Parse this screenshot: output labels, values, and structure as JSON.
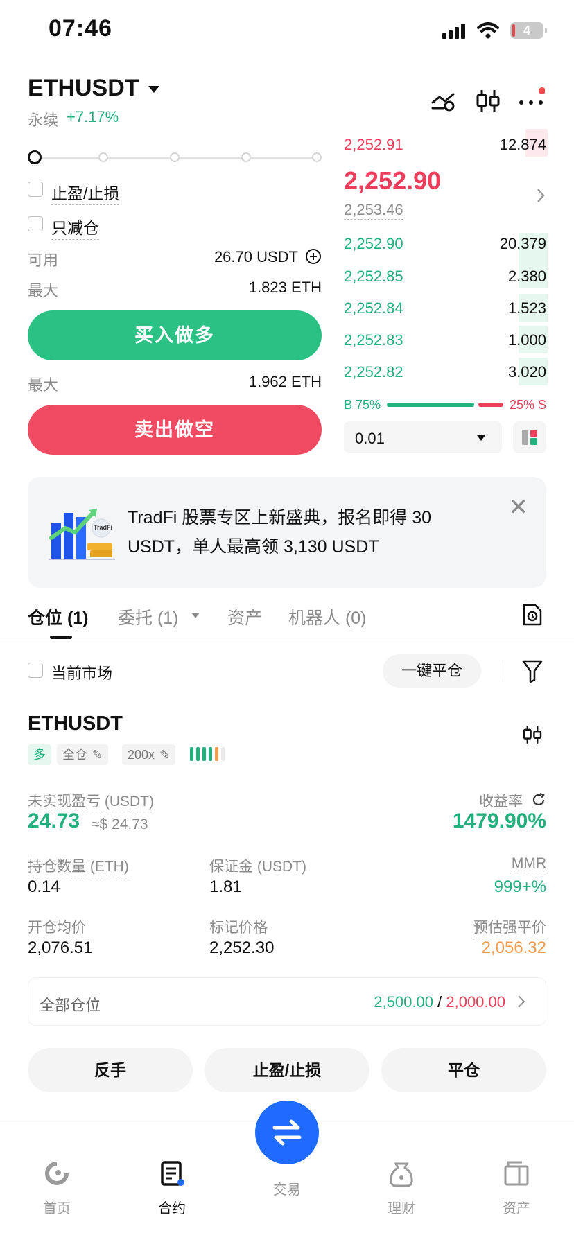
{
  "status_bar": {
    "time": "07:46",
    "battery": "4"
  },
  "header": {
    "pair": "ETHUSDT",
    "contract_type": "永续",
    "change_pct": "+7.17%"
  },
  "order_form": {
    "tp_sl_label": "止盈/止损",
    "reduce_only_label": "只减仓",
    "available_label": "可用",
    "available_value": "26.70 USDT",
    "max_label": "最大",
    "max_buy_value": "1.823 ETH",
    "buy_button": "买入做多",
    "max_sell_value": "1.962 ETH",
    "sell_button": "卖出做空"
  },
  "order_book": {
    "ask": {
      "price": "2,252.91",
      "qty": "12.874"
    },
    "last_price": "2,252.90",
    "mark_price": "2,253.46",
    "bids": [
      {
        "price": "2,252.90",
        "qty": "20.379"
      },
      {
        "price": "2,252.85",
        "qty": "2.380"
      },
      {
        "price": "2,252.84",
        "qty": "1.523"
      },
      {
        "price": "2,252.83",
        "qty": "1.000"
      },
      {
        "price": "2,252.82",
        "qty": "3.020"
      }
    ],
    "buy_ratio": "B 75%",
    "sell_ratio": "25% S",
    "buy_ratio_fraction": 0.75,
    "precision_value": "0.01"
  },
  "banner": {
    "text": "TradFi 股票专区上新盛典，报名即得 30 USDT，单人最高领 3,130 USDT",
    "logo_text": "TradFi"
  },
  "tabs": [
    {
      "label": "仓位 (1)"
    },
    {
      "label": "委托 (1)"
    },
    {
      "label": "资产"
    },
    {
      "label": "机器人 (0)"
    }
  ],
  "filter": {
    "current_market_label": "当前市场",
    "close_all_label": "一键平仓"
  },
  "position": {
    "symbol": "ETHUSDT",
    "side_tag": "多",
    "margin_mode_tag": "全仓",
    "leverage_tag": "200x",
    "unrealized_pnl_label": "未实现盈亏 (USDT)",
    "unrealized_pnl_value": "24.73",
    "unrealized_pnl_usd": "≈$ 24.73",
    "roi_label": "收益率",
    "roi_value": "1479.90%",
    "size_label": "持仓数量 (ETH)",
    "size_value": "0.14",
    "margin_label": "保证金 (USDT)",
    "margin_value": "1.81",
    "mmr_label": "MMR",
    "mmr_value": "999+%",
    "entry_label": "开仓均价",
    "entry_value": "2,076.51",
    "mark_label": "标记价格",
    "mark_value": "2,252.30",
    "liq_label": "预估强平价",
    "liq_value": "2,056.32",
    "all_positions_label": "全部仓位",
    "all_positions_green": "2,500.00",
    "all_positions_sep": "/",
    "all_positions_red": "2,000.00"
  },
  "actions": {
    "reverse": "反手",
    "tp_sl": "止盈/止损",
    "close": "平仓"
  },
  "nav": {
    "home": "首页",
    "contract": "合约",
    "trade": "交易",
    "finance": "理财",
    "assets": "资产"
  },
  "colors": {
    "green": "#22b07d",
    "red": "#ef3e5c",
    "orange": "#f39a4c",
    "fab_blue": "#1f6bff"
  }
}
